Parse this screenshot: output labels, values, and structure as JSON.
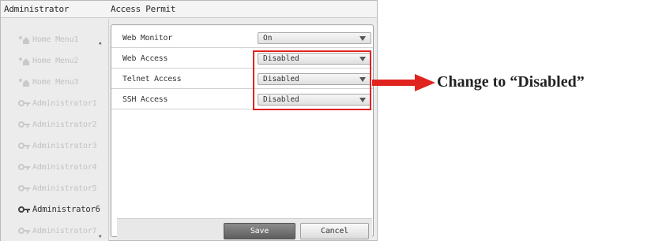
{
  "header": {
    "left_title": "Administrator",
    "right_title": "Access Permit"
  },
  "sidebar": {
    "items": [
      {
        "label": "Home Menu1",
        "icon": "home-icon",
        "active": false
      },
      {
        "label": "Home Menu2",
        "icon": "home-icon",
        "active": false
      },
      {
        "label": "Home Menu3",
        "icon": "home-icon",
        "active": false
      },
      {
        "label": "Administrator1",
        "icon": "key-icon",
        "active": false
      },
      {
        "label": "Administrator2",
        "icon": "key-icon",
        "active": false
      },
      {
        "label": "Administrator3",
        "icon": "key-icon",
        "active": false
      },
      {
        "label": "Administrator4",
        "icon": "key-icon",
        "active": false
      },
      {
        "label": "Administrator5",
        "icon": "key-icon",
        "active": false
      },
      {
        "label": "Administrator6",
        "icon": "key-icon",
        "active": true
      },
      {
        "label": "Administrator7",
        "icon": "key-icon",
        "active": false
      }
    ]
  },
  "settings": {
    "rows": [
      {
        "label": "Web Monitor",
        "value": "On"
      },
      {
        "label": "Web Access",
        "value": "Disabled"
      },
      {
        "label": "Telnet Access",
        "value": "Disabled"
      },
      {
        "label": "SSH Access",
        "value": "Disabled"
      }
    ]
  },
  "footer": {
    "save_label": "Save",
    "cancel_label": "Cancel"
  },
  "annotation": {
    "text": "Change to “Disabled”",
    "color": "#e0231f"
  }
}
